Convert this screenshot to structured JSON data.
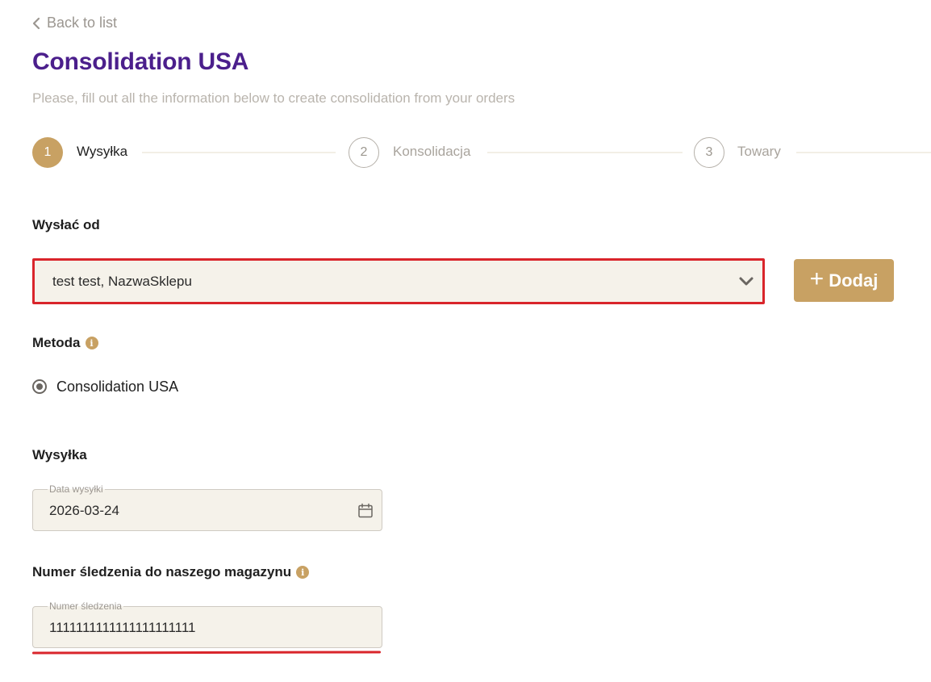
{
  "nav": {
    "back_label": "Back to list"
  },
  "header": {
    "title": "Consolidation USA",
    "subtitle": "Please, fill out all the information below to create consolidation from your orders"
  },
  "steps": [
    {
      "number": "1",
      "label": "Wysyłka",
      "state": "active"
    },
    {
      "number": "2",
      "label": "Konsolidacja",
      "state": "idle"
    },
    {
      "number": "3",
      "label": "Towary",
      "state": "idle"
    }
  ],
  "send_from": {
    "label": "Wysłać od",
    "selected": "test test, NazwaSklepu",
    "add_button": "Dodaj"
  },
  "method": {
    "label": "Metoda",
    "info_icon": "i",
    "options": [
      {
        "label": "Consolidation USA",
        "selected": true
      }
    ]
  },
  "shipping": {
    "label": "Wysyłka",
    "date_label": "Data wysyłki",
    "date_value": "2026-03-24"
  },
  "tracking": {
    "label": "Numer śledzenia do naszego magazynu",
    "info_icon": "i",
    "field_label": "Numer śledzenia",
    "value": "1111111111111111111111"
  },
  "colors": {
    "accent": "#c8a163",
    "title": "#4b1f8c",
    "error": "#d9252b",
    "field_bg": "#f5f2ea"
  }
}
